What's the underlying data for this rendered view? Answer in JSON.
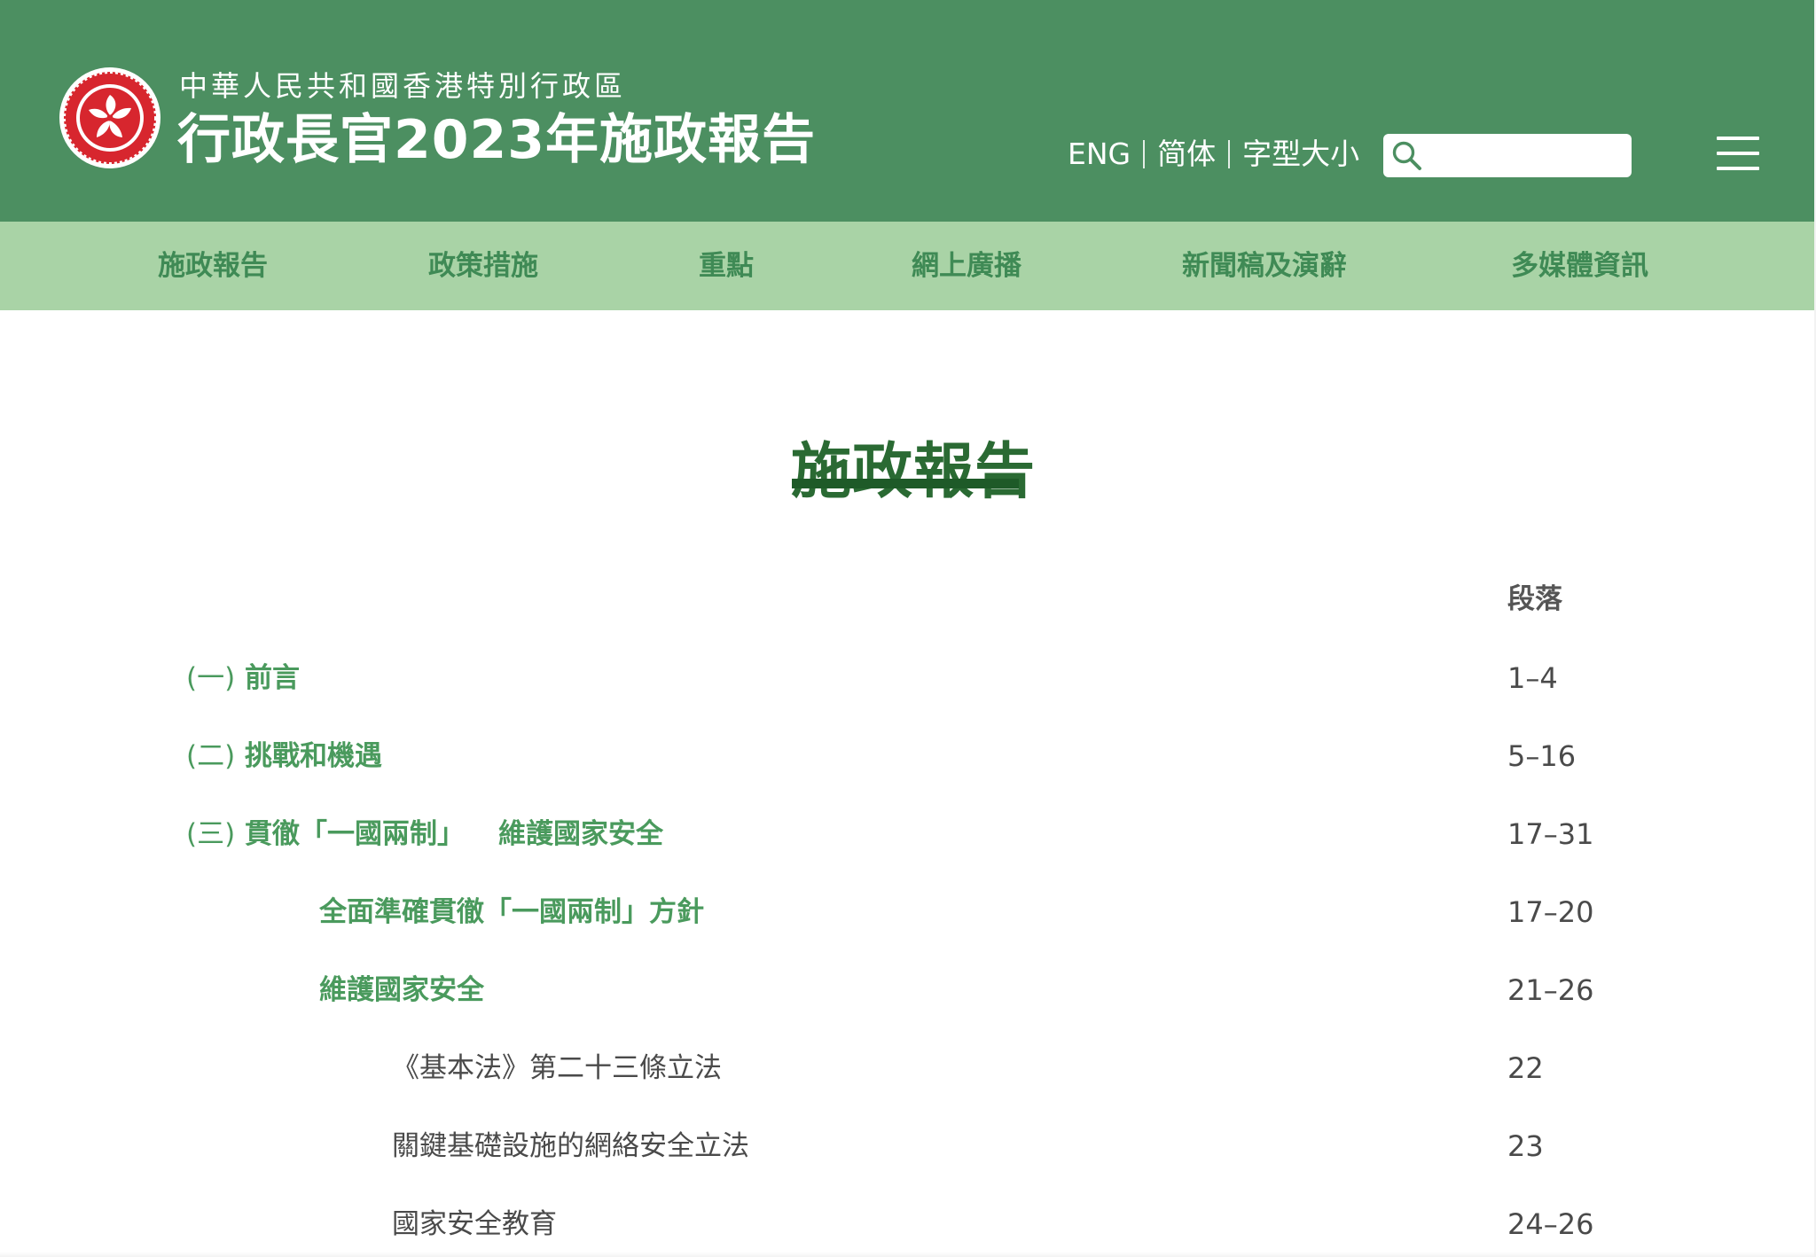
{
  "header": {
    "subtitle": "中華人民共和國香港特別行政區",
    "title": "行政長官2023年施政報告",
    "language_english": "ENG",
    "language_simplified": "简体",
    "font_size": "字型大小",
    "search_placeholder": "",
    "menu_icon": "hamburger-menu-icon"
  },
  "nav": [
    {
      "label": "施政報告"
    },
    {
      "label": "政策措施"
    },
    {
      "label": "重點"
    },
    {
      "label": "網上廣播"
    },
    {
      "label": "新聞稿及演辭"
    },
    {
      "label": "多媒體資訊"
    }
  ],
  "main": {
    "title": "施政報告",
    "paragraph_header": "段落",
    "toc": [
      {
        "number": "(一)",
        "title": "前言",
        "paragraphs": "1–4",
        "level": "section"
      },
      {
        "number": "(二)",
        "title": "挑戰和機遇",
        "paragraphs": "5–16",
        "level": "section"
      },
      {
        "number": "(三)",
        "title": "貫徹「一國兩制」",
        "title_part_2": "維護國家安全",
        "paragraphs": "17–31",
        "level": "section"
      },
      {
        "title": "全面準確貫徹「一國兩制」方針",
        "paragraphs": "17–20",
        "level": "subsection"
      },
      {
        "title": "維護國家安全",
        "paragraphs": "21–26",
        "level": "subsection"
      },
      {
        "title": "《基本法》第二十三條立法",
        "paragraphs": "22",
        "level": "plain"
      },
      {
        "title": "關鍵基礎設施的網絡安全立法",
        "paragraphs": "23",
        "level": "plain"
      },
      {
        "title": "國家安全教育",
        "paragraphs": "24–26",
        "level": "plain"
      }
    ]
  },
  "colors": {
    "header_green": "#4c8f61",
    "nav_green": "#a9d3a6",
    "link_green": "#4a9a5d",
    "title_green": "#2a6a33",
    "underline_green": "#1e5a28",
    "text_gray": "#4a4a4a",
    "emblem_red": "#d7262e"
  }
}
